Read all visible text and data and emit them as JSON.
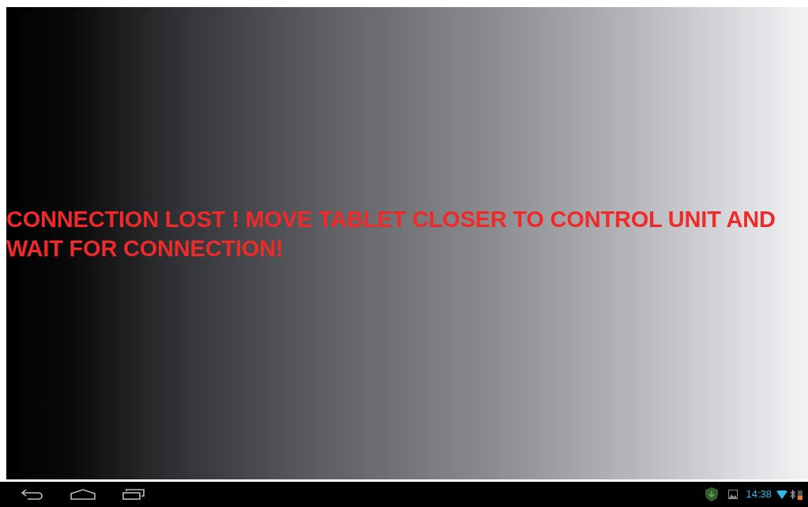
{
  "message": {
    "text": "CONNECTION LOST ! MOVE TABLET CLOSER TO CONTROL UNIT AND WAIT FOR CONNECTION!"
  },
  "status_bar": {
    "time": "14:38"
  }
}
